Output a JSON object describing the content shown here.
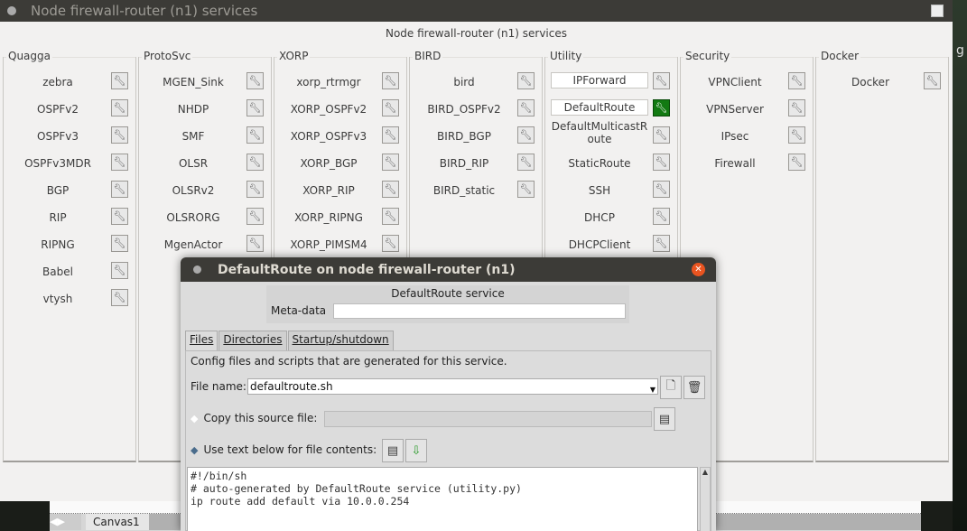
{
  "window": {
    "title": "Node firewall-router (n1) services",
    "header": "Node firewall-router (n1) services"
  },
  "desktop_char": "g",
  "groups": [
    {
      "name": "Quagga",
      "items": [
        "zebra",
        "OSPFv2",
        "OSPFv3",
        "OSPFv3MDR",
        "BGP",
        "RIP",
        "RIPNG",
        "Babel",
        "vtysh"
      ]
    },
    {
      "name": "ProtoSvc",
      "items": [
        "MGEN_Sink",
        "NHDP",
        "SMF",
        "OLSR",
        "OLSRv2",
        "OLSRORG",
        "MgenActor"
      ]
    },
    {
      "name": "XORP",
      "items": [
        "xorp_rtrmgr",
        "XORP_OSPFv2",
        "XORP_OSPFv3",
        "XORP_BGP",
        "XORP_RIP",
        "XORP_RIPNG",
        "XORP_PIMSM4"
      ]
    },
    {
      "name": "BIRD",
      "items": [
        "bird",
        "BIRD_OSPFv2",
        "BIRD_BGP",
        "BIRD_RIP",
        "BIRD_static"
      ]
    },
    {
      "name": "Utility",
      "items": [
        "IPForward",
        "DefaultRoute",
        "DefaultMulticastRoute",
        "StaticRoute",
        "SSH",
        "DHCP",
        "DHCPClient"
      ],
      "enabled": [
        "IPForward",
        "DefaultRoute"
      ],
      "selected": "DefaultRoute"
    },
    {
      "name": "Security",
      "items": [
        "VPNClient",
        "VPNServer",
        "IPsec",
        "Firewall"
      ]
    },
    {
      "name": "Docker",
      "items": [
        "Docker"
      ]
    }
  ],
  "canvas": {
    "tab": "Canvas1"
  },
  "dialog": {
    "title": "DefaultRoute on node firewall-router (n1)",
    "service_title": "DefaultRoute service",
    "meta_label": "Meta-data",
    "meta_value": "",
    "tabs": [
      "Files",
      "Directories",
      "Startup/shutdown"
    ],
    "active_tab": "Files",
    "description": "Config files and scripts that are generated for this service.",
    "file_name_label": "File name:",
    "file_name": "defaultroute.sh",
    "copy_label": "Copy this source file:",
    "copy_value": "",
    "use_text_label": "Use text below for file contents:",
    "selected_option": "use_text",
    "contents": "#!/bin/sh\n# auto-generated by DefaultRoute service (utility.py)\nip route add default via 10.0.0.254"
  },
  "colors": {
    "selected_button": "#127a12",
    "titlebar": "#3c3b37",
    "close": "#e95420"
  }
}
